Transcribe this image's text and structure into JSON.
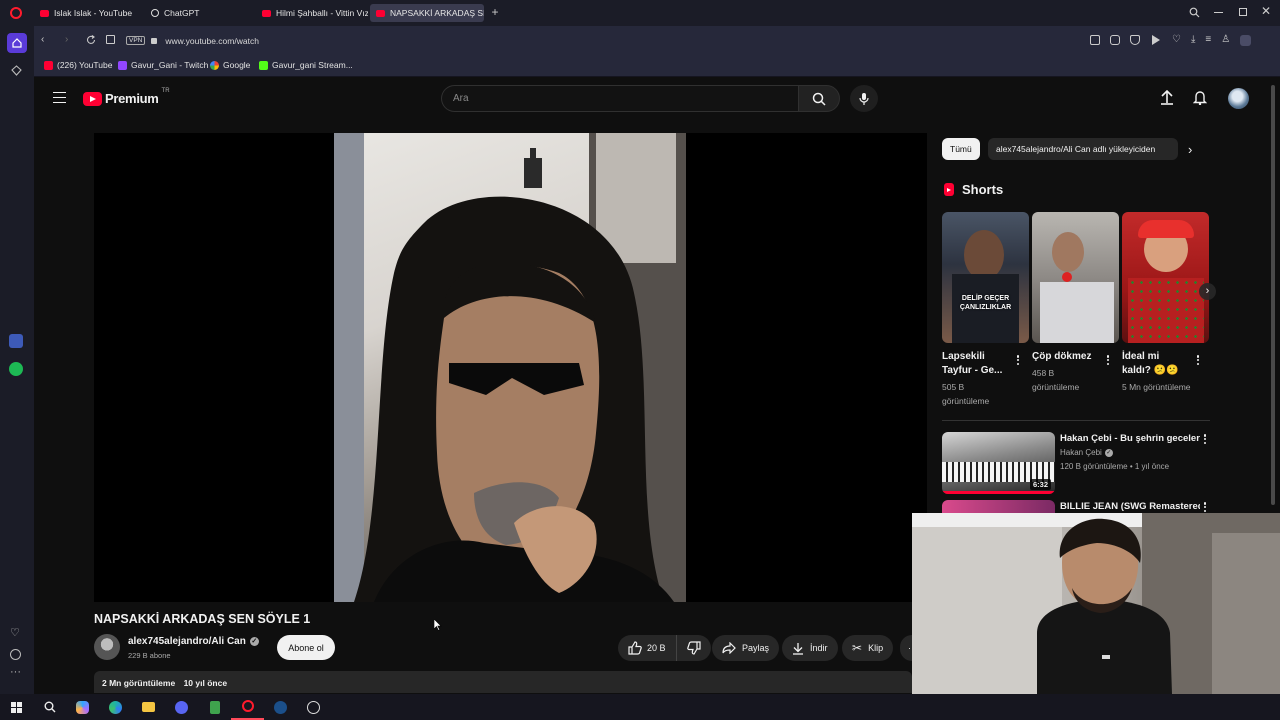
{
  "browser": {
    "tabs": [
      {
        "label": "Islak Islak - YouTube",
        "icon": "youtube-icon",
        "active": false
      },
      {
        "label": "ChatGPT",
        "icon": "chatgpt-icon",
        "active": false
      },
      {
        "label": "Hilmi Şahballı - Vittin Vızı",
        "icon": "youtube-icon",
        "active": false
      },
      {
        "label": "NAPSAKKİ ARKADAŞ SEN",
        "icon": "youtube-icon",
        "active": true
      }
    ],
    "vpn_label": "VPN",
    "url": "www.youtube.com/watch",
    "bookmarks": [
      {
        "label": "(226) YouTube",
        "icon": "youtube-icon"
      },
      {
        "label": "Gavur_Gani - Twitch",
        "icon": "twitch-icon"
      },
      {
        "label": "Google",
        "icon": "google-icon"
      },
      {
        "label": "Gavur_gani Stream...",
        "icon": "kick-icon"
      }
    ]
  },
  "youtube": {
    "logo_text": "Premium",
    "region": "TR",
    "search_placeholder": "Ara",
    "video": {
      "title": "NAPSAKKİ ARKADAŞ SEN SÖYLE 1",
      "channel": "alex745alejandro/Ali Can",
      "subscribers": "229 B abone",
      "subscribe_label": "Abone ol",
      "likes": "20 B",
      "share_label": "Paylaş",
      "download_label": "İndir",
      "clip_label": "Klip",
      "views": "2 Mn görüntüleme",
      "age": "10 yıl önce"
    },
    "chips": [
      "Tümü",
      "alex745alejandro/Ali Can adlı yükleyiciden"
    ],
    "shorts_title": "Shorts",
    "shorts": [
      {
        "title": "Lapsekili Tayfur - Ge...",
        "views": "505 B görüntüleme",
        "overlay": "DELİP GEÇER ÇANLIZLIKLAR"
      },
      {
        "title": "Çöp dökmez",
        "views": "458 B görüntüleme",
        "overlay": ""
      },
      {
        "title": "İdeal mi kaldı? 😕😕",
        "views": "5 Mn görüntüleme",
        "overlay": ""
      }
    ],
    "recommended": [
      {
        "title": "Hakan Çebi - Bu şehrin geceleri",
        "channel": "Hakan Çebi",
        "meta": "120 B görüntüleme • 1 yıl önce",
        "duration": "6:32"
      },
      {
        "title": "BILLIE JEAN (SWG Remastered",
        "channel": "",
        "meta": "",
        "duration": ""
      }
    ]
  },
  "colors": {
    "accent": "#ff0033",
    "background": "#0f0f0f",
    "chrome": "#26283a"
  }
}
